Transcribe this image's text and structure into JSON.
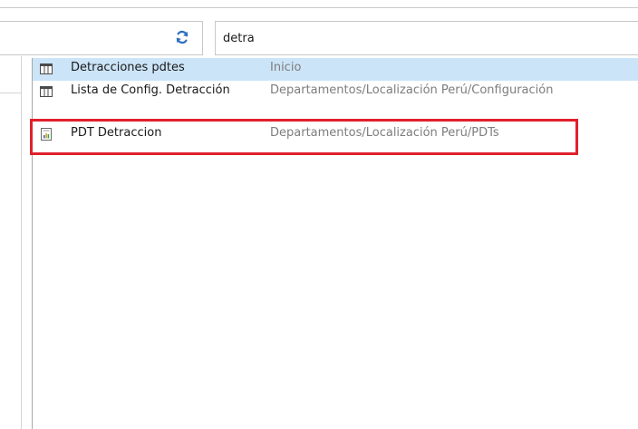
{
  "search": {
    "value": "detra"
  },
  "results": [
    {
      "name": "Detracciones pdtes",
      "path": "Inicio",
      "icon": "table-icon",
      "selected": true
    },
    {
      "name": "Lista de Config. Detracción",
      "path": "Departamentos/Localización Perú/Configuración",
      "icon": "table-icon",
      "selected": false
    },
    {
      "name": "PDT Detraccion",
      "path": "Departamentos/Localización Perú/PDTs",
      "icon": "report-icon",
      "selected": false
    }
  ],
  "colors": {
    "selection": "#cce4f7",
    "highlight": "#e0202c",
    "refresh_icon": "#2f6fbf"
  }
}
